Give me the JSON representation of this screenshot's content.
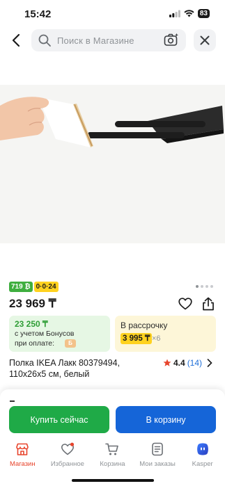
{
  "status_bar": {
    "time": "15:42",
    "battery": "83"
  },
  "header": {
    "search_placeholder": "Поиск в Магазине",
    "icons": [
      "back-arrow-icon",
      "search-icon",
      "camera-icon",
      "close-icon"
    ]
  },
  "gallery": {
    "page_count": 4,
    "active_index": 0
  },
  "product": {
    "badge_bonus": "719 ₿",
    "badge_installment": "0·0·24",
    "price": "23 969 ₸",
    "title_line1": "Полка IKEA Лакк 80379494,",
    "title_line2": "110x26x5 см, белый",
    "rating": "4.4",
    "reviews": "(14)"
  },
  "bonus_card": {
    "price": "23 250 ₸",
    "line1": "с учетом Бонусов",
    "line2": "при оплате:",
    "coin": "Б"
  },
  "credit_card": {
    "title": "В рассрочку",
    "amount": "3 995 ₸",
    "multiplier": "×6"
  },
  "actions": {
    "buy_now": "Купить сейчас",
    "add_to_cart": "В корзину"
  },
  "tabbar": {
    "items": [
      {
        "label": "Магазин",
        "icon": "shop-icon",
        "active": true
      },
      {
        "label": "Избранное",
        "icon": "heart-icon",
        "active": false
      },
      {
        "label": "Корзина",
        "icon": "cart-icon",
        "active": false
      },
      {
        "label": "Мои заказы",
        "icon": "orders-icon",
        "active": false
      },
      {
        "label": "Kasper",
        "icon": "kasper-assistant-icon",
        "active": false
      }
    ]
  },
  "colors": {
    "accent_red": "#e7442c",
    "buy_green": "#1faa47",
    "cart_blue": "#1565d8",
    "bonus_green": "#3fae3f",
    "installment_yellow": "#ffd21f"
  }
}
